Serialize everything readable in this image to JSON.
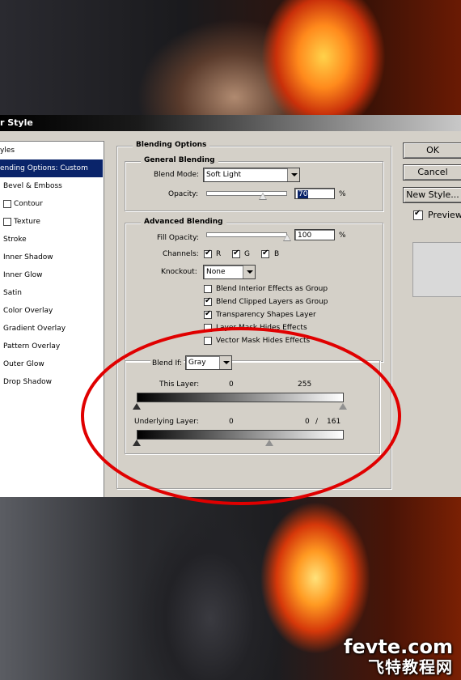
{
  "window": {
    "title": "r Style"
  },
  "styles_list": {
    "items": [
      {
        "label": "yles",
        "checkbox": false,
        "selected": false
      },
      {
        "label": "ending Options: Custom",
        "checkbox": false,
        "selected": true
      },
      {
        "label": "Bevel & Emboss",
        "checkbox": false,
        "selected": false
      },
      {
        "label": "Contour",
        "checkbox": true,
        "selected": false
      },
      {
        "label": "Texture",
        "checkbox": true,
        "selected": false
      },
      {
        "label": "Stroke",
        "checkbox": false,
        "selected": false
      },
      {
        "label": "Inner Shadow",
        "checkbox": false,
        "selected": false
      },
      {
        "label": "Inner Glow",
        "checkbox": false,
        "selected": false
      },
      {
        "label": "Satin",
        "checkbox": false,
        "selected": false
      },
      {
        "label": "Color Overlay",
        "checkbox": false,
        "selected": false
      },
      {
        "label": "Gradient Overlay",
        "checkbox": false,
        "selected": false
      },
      {
        "label": "Pattern Overlay",
        "checkbox": false,
        "selected": false
      },
      {
        "label": "Outer Glow",
        "checkbox": false,
        "selected": false
      },
      {
        "label": "Drop Shadow",
        "checkbox": false,
        "selected": false
      }
    ]
  },
  "blending_options": {
    "title": "Blending Options",
    "general": {
      "title": "General Blending",
      "blend_mode_label": "Blend Mode:",
      "blend_mode_value": "Soft Light",
      "opacity_label": "Opacity:",
      "opacity_value": "70",
      "opacity_unit": "%",
      "opacity_level": 0.7
    },
    "advanced": {
      "title": "Advanced Blending",
      "fill_opacity_label": "Fill Opacity:",
      "fill_opacity_value": "100",
      "fill_opacity_unit": "%",
      "fill_opacity_level": 1.0,
      "channels_label": "Channels:",
      "channels": [
        {
          "label": "R",
          "checked": true
        },
        {
          "label": "G",
          "checked": true
        },
        {
          "label": "B",
          "checked": true
        }
      ],
      "knockout_label": "Knockout:",
      "knockout_value": "None",
      "options": [
        {
          "label": "Blend Interior Effects as Group",
          "checked": false
        },
        {
          "label": "Blend Clipped Layers as Group",
          "checked": true
        },
        {
          "label": "Transparency Shapes Layer",
          "checked": true
        },
        {
          "label": "Layer Mask Hides Effects",
          "checked": false
        },
        {
          "label": "Vector Mask Hides Effects",
          "checked": false
        }
      ]
    },
    "blend_if": {
      "label": "Blend If:",
      "value": "Gray",
      "this_layer_label": "This Layer:",
      "this_layer_low": "0",
      "this_layer_high": "255",
      "underlying_label": "Underlying Layer:",
      "underlying_low": "0",
      "underlying_split": "0",
      "underlying_sep": "/",
      "underlying_high": "161"
    }
  },
  "buttons": {
    "ok": "OK",
    "cancel": "Cancel",
    "new_style": "New Style..."
  },
  "preview": {
    "label": "Preview",
    "checked": true
  },
  "watermark": {
    "domain": "fevte.com",
    "cn": "飞特教程网"
  },
  "colors": {
    "selection": "#0a246a",
    "dialog_bg": "#d4d0c8",
    "annotation": "#e00000"
  }
}
